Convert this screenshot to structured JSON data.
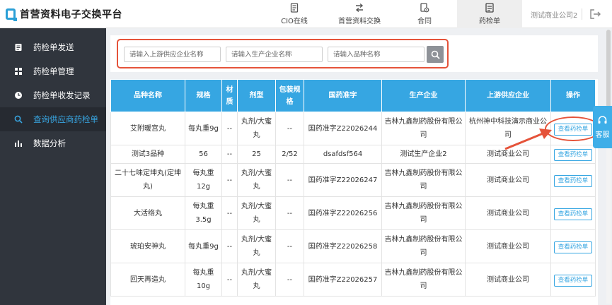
{
  "app": {
    "title": "首营资料电子交换平台"
  },
  "nav": [
    {
      "label": "CIO在线",
      "icon": "document-icon"
    },
    {
      "label": "首营资料交换",
      "icon": "exchange-arrows-icon"
    },
    {
      "label": "合同",
      "icon": "contract-gear-icon"
    },
    {
      "label": "药检单",
      "icon": "report-sheet-icon",
      "active": true
    }
  ],
  "header": {
    "company": "测试商业公司2"
  },
  "sidebar": {
    "items": [
      {
        "label": "药检单发送",
        "icon": "clipboard-icon"
      },
      {
        "label": "药检单管理",
        "icon": "grid-icon"
      },
      {
        "label": "药检单收发记录",
        "icon": "clock-icon"
      },
      {
        "label": "查询供应商药检单",
        "icon": "search-icon",
        "active": true
      },
      {
        "label": "数据分析",
        "icon": "bar-chart-icon"
      }
    ]
  },
  "search": {
    "supplier_placeholder": "请输入上游供应企业名称",
    "manufacturer_placeholder": "请输入生产企业名称",
    "variety_placeholder": "请输入品种名称"
  },
  "table": {
    "headers": [
      "品种名称",
      "规格",
      "材质",
      "剂型",
      "包装规格",
      "国药准字",
      "生产企业",
      "上游供应企业",
      "操作"
    ],
    "action_label": "查看药检单",
    "rows": [
      [
        "艾附暖宫丸",
        "每丸重9g",
        "--",
        "丸剂/大蜜丸",
        "--",
        "国药准字Z22026244",
        "吉林九鑫制药股份有限公司",
        "杭州神中科技演示商业公司"
      ],
      [
        "测试3品种",
        "56",
        "--",
        "25",
        "2/52",
        "dsafdsf564",
        "测试生产企业2",
        "测试商业公司"
      ],
      [
        "二十七味定坤丸(定坤丸)",
        "每丸重12g",
        "--",
        "丸剂/大蜜丸",
        "--",
        "国药准字Z22026247",
        "吉林九鑫制药股份有限公司",
        "测试商业公司"
      ],
      [
        "大活络丸",
        "每丸重3.5g",
        "--",
        "丸剂/大蜜丸",
        "--",
        "国药准字Z22026256",
        "吉林九鑫制药股份有限公司",
        "测试商业公司"
      ],
      [
        "琥珀安神丸",
        "每丸重9g",
        "--",
        "丸剂/大蜜丸",
        "--",
        "国药准字Z22026258",
        "吉林九鑫制药股份有限公司",
        "测试商业公司"
      ],
      [
        "回天再造丸",
        "每丸重10g",
        "--",
        "丸剂/大蜜丸",
        "--",
        "国药准字Z22026257",
        "吉林九鑫制药股份有限公司",
        "测试商业公司"
      ]
    ]
  },
  "service": {
    "label": "客服"
  },
  "colors": {
    "accent": "#36a6e2",
    "sidebar": "#30353d",
    "annotation": "#e5533a"
  }
}
